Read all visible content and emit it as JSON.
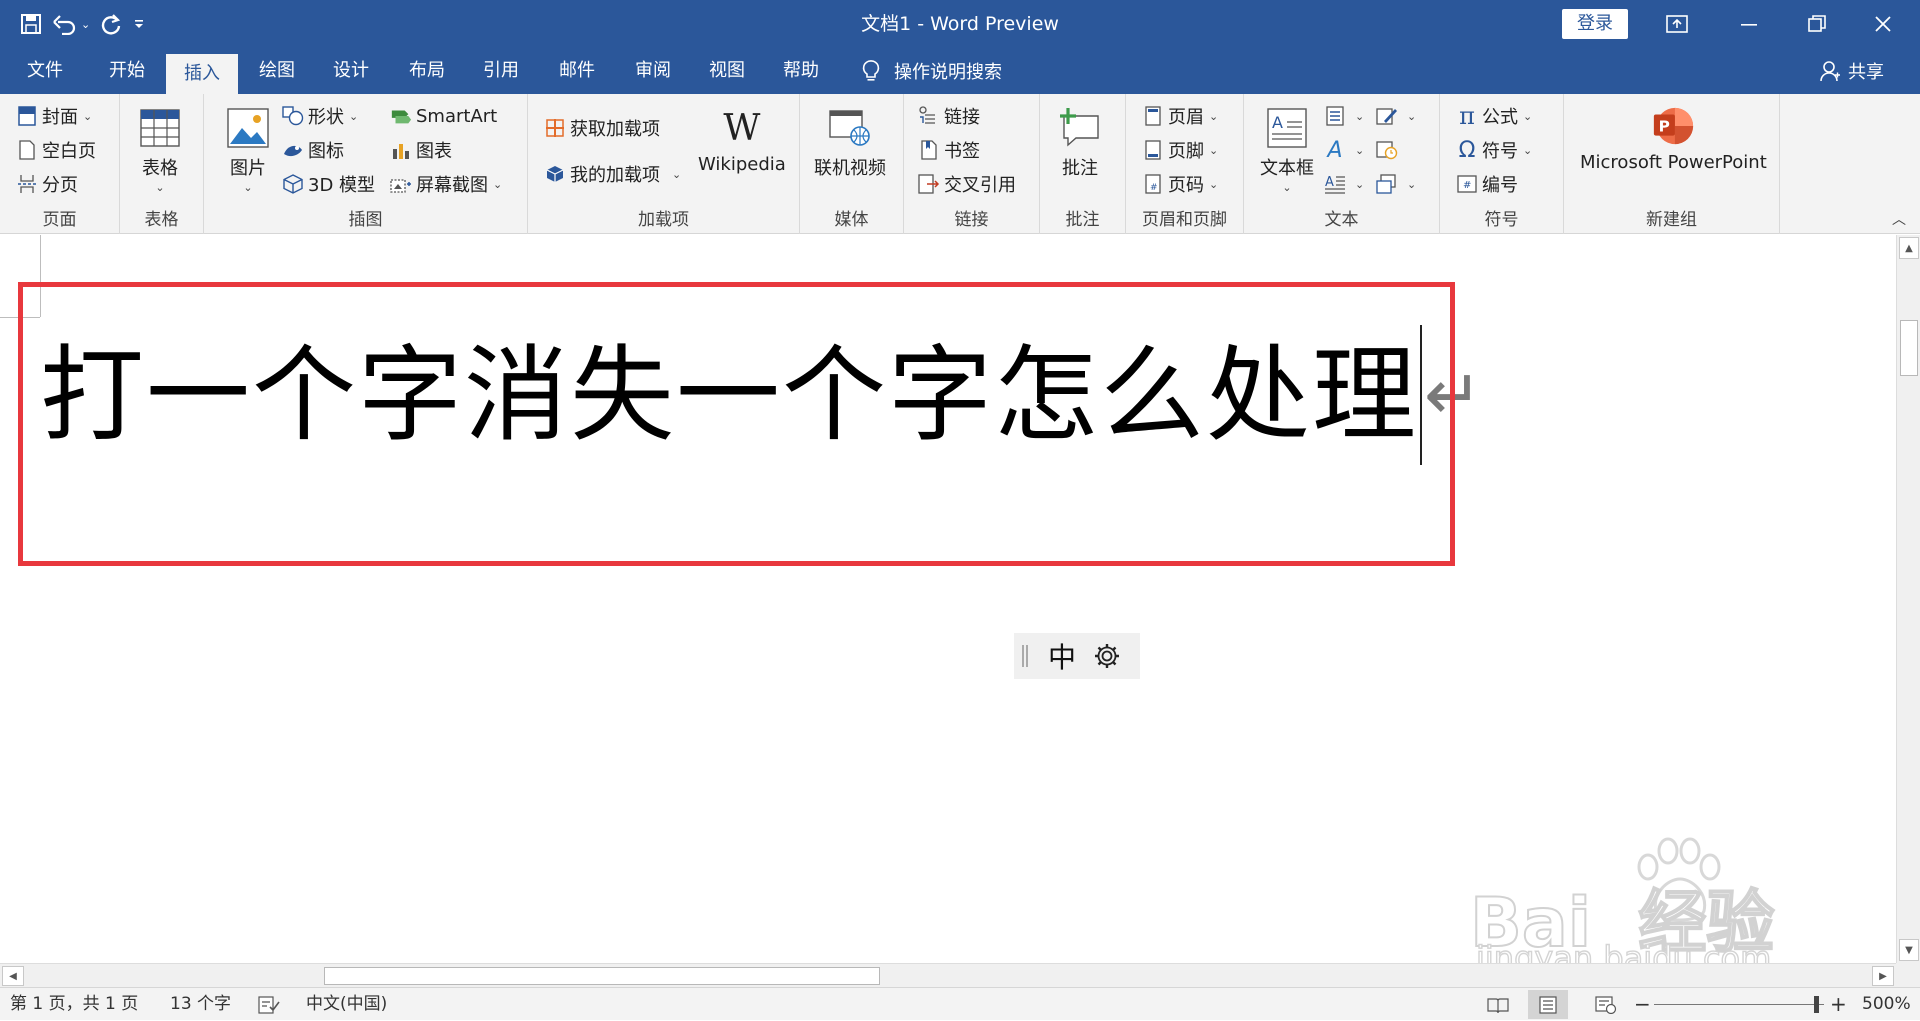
{
  "title_bar": {
    "title": "文档1  -  Word Preview",
    "login_label": "登录",
    "qat": {
      "save_icon": "save-icon",
      "undo_icon": "undo-icon",
      "redo_icon": "redo-icon",
      "customize_icon": "customize-qat-icon"
    },
    "window_controls": [
      "ribbon-display-options-icon",
      "minimize-icon",
      "restore-icon",
      "close-icon"
    ]
  },
  "menu": {
    "tabs": [
      {
        "label": "文件"
      },
      {
        "label": "开始"
      },
      {
        "label": "插入",
        "active": true
      },
      {
        "label": "绘图"
      },
      {
        "label": "设计"
      },
      {
        "label": "布局"
      },
      {
        "label": "引用"
      },
      {
        "label": "邮件"
      },
      {
        "label": "审阅"
      },
      {
        "label": "视图"
      },
      {
        "label": "帮助"
      }
    ],
    "search_label": "操作说明搜索",
    "share_label": "共享"
  },
  "ribbon": {
    "pages": {
      "label": "页面",
      "cover": "封面",
      "blank_page": "空白页",
      "page_break": "分页"
    },
    "tables": {
      "label": "表格",
      "table": "表格"
    },
    "illustrations": {
      "label": "插图",
      "pictures": "图片",
      "shapes": "形状",
      "icons": "图标",
      "model3d": "3D 模型",
      "smartart": "SmartArt",
      "chart": "图表",
      "screenshot": "屏幕截图"
    },
    "addins": {
      "label": "加载项",
      "get_addins": "获取加载项",
      "my_addins": "我的加载项",
      "wikipedia": "Wikipedia"
    },
    "media": {
      "label": "媒体",
      "online_video": "联机视频"
    },
    "links": {
      "label": "链接",
      "link": "链接",
      "bookmark": "书签",
      "cross_ref": "交叉引用"
    },
    "comments": {
      "label": "批注",
      "comment": "批注"
    },
    "header_footer": {
      "label": "页眉和页脚",
      "header": "页眉",
      "footer": "页脚",
      "page_number": "页码"
    },
    "text": {
      "label": "文本",
      "text_box": "文本框"
    },
    "symbols": {
      "label": "符号",
      "equation": "公式",
      "symbol": "符号",
      "number": "编号"
    },
    "new_group": {
      "label": "新建组",
      "powerpoint": "Microsoft PowerPoint"
    }
  },
  "document": {
    "text": "打一个字消失一个字怎么处理",
    "paragraph_mark": "↵",
    "highlight_color": "#e8383d"
  },
  "ime": {
    "mode": "中"
  },
  "watermark": {
    "brand": "Bai  经验",
    "url": "jingyan.baidu.com"
  },
  "status": {
    "page_info": "第 1 页，共 1 页",
    "word_count": "13 个字",
    "language": "中文(中国)",
    "zoom_level": "500%",
    "zoom_fraction": 0.95
  },
  "colors": {
    "accent": "#2b579a",
    "ribbon_bg": "#f3f3f3"
  }
}
